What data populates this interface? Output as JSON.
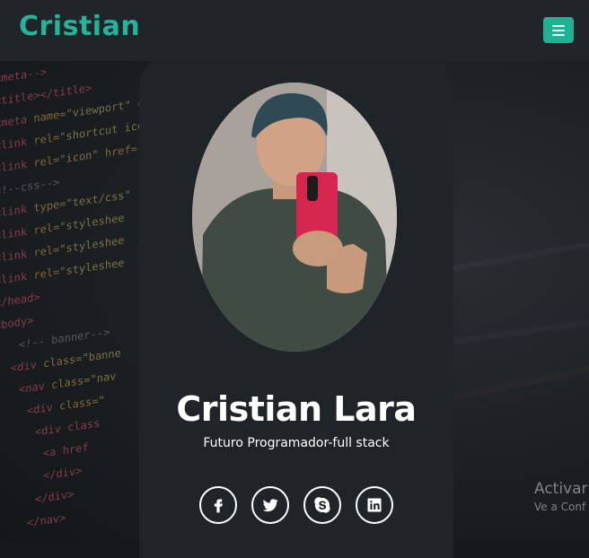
{
  "navbar": {
    "brand": "Cristian",
    "menu_icon": "hamburger-icon"
  },
  "background_code": [
    "<meta-->",
    "<title></title>",
    "<meta name=\"viewport\" co",
    "<link rel=\"shortcut ico",
    "<link rel=\"icon\" href=\"",
    "<!--css-->",
    "<link type=\"text/css\"",
    "<link rel=\"styleshee",
    "<link rel=\"styleshee",
    "<link rel=\"styleshee",
    "</head>",
    "<body>",
    "<!-- banner-->",
    "<div class=\"banne",
    "<nav class=\"nav",
    "<div class=\"",
    "<div class",
    "<a href",
    "</div>",
    "</div>",
    "</nav>"
  ],
  "profile": {
    "name": "Cristian Lara",
    "subtitle": "Futuro Programador-full stack"
  },
  "socials": [
    {
      "name": "facebook",
      "icon": "facebook-icon"
    },
    {
      "name": "twitter",
      "icon": "twitter-icon"
    },
    {
      "name": "skype",
      "icon": "skype-icon"
    },
    {
      "name": "linkedin",
      "icon": "linkedin-icon"
    }
  ],
  "watermark": {
    "title": "Activar",
    "subtitle": "Ve a Conf"
  },
  "colors": {
    "accent": "#1fb193",
    "brand": "#25b399",
    "card": "#1e2427",
    "navbar": "#1f2528"
  }
}
